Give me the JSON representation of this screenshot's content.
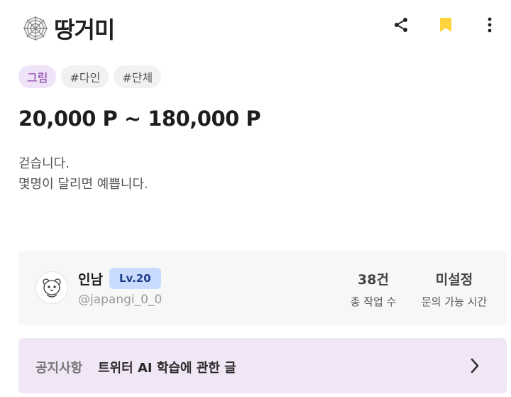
{
  "header": {
    "title": "땅거미",
    "title_icon": "spider-web-icon",
    "actions": {
      "share_icon": "share-icon",
      "bookmark_icon": "bookmark-icon",
      "more_icon": "more-vertical-icon"
    }
  },
  "tags": [
    {
      "label": "그림",
      "primary": true
    },
    {
      "label": "#다인",
      "primary": false
    },
    {
      "label": "#단체",
      "primary": false
    }
  ],
  "price": "20,000 P ~ 180,000 P",
  "description": {
    "line1": "걷습니다.",
    "line2": "몇명이 달리면 예쁩니다."
  },
  "profile": {
    "name": "인남",
    "level": "Lv.20",
    "handle": "@japangi_0_0",
    "stats": [
      {
        "value": "38건",
        "label": "총 작업 수"
      },
      {
        "value": "미설정",
        "label": "문의 가능 시간"
      }
    ]
  },
  "notice": {
    "label": "공지사항",
    "text": "트위터 AI 학습에 관한 글"
  },
  "colors": {
    "accent_purple": "#7b2f9e",
    "tag_primary_bg": "#efe3f7",
    "bookmark": "#ffd33d",
    "level_badge_bg": "#c9dcff",
    "notice_bg": "#f1e6f6"
  }
}
